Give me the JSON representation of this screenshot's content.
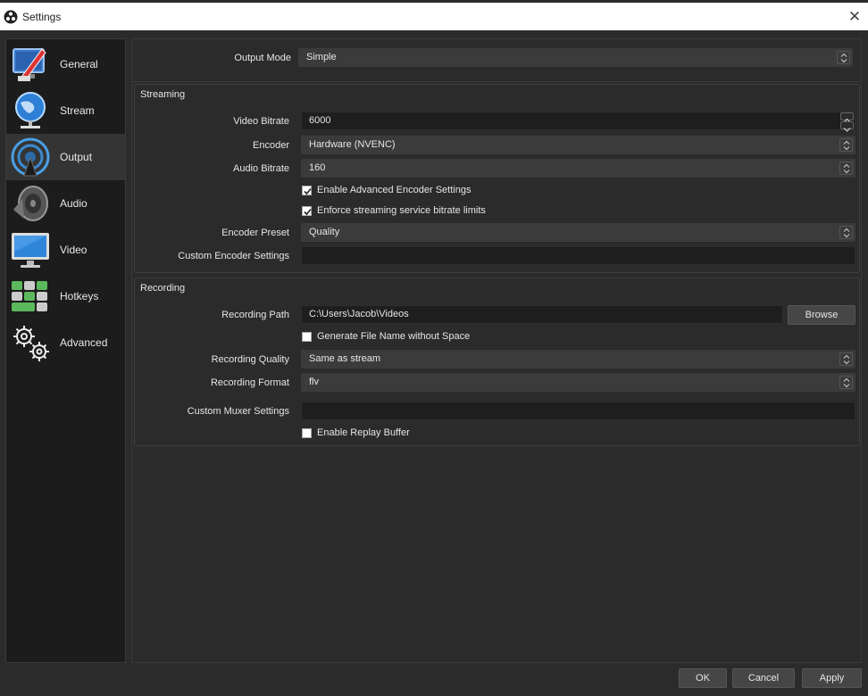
{
  "window": {
    "title": "Settings",
    "icon": "obs-logo-icon",
    "close_icon": "close-icon"
  },
  "sidebar": {
    "items": [
      {
        "label": "General",
        "icon": "general-settings-icon",
        "active": false
      },
      {
        "label": "Stream",
        "icon": "stream-globe-icon",
        "active": false
      },
      {
        "label": "Output",
        "icon": "output-broadcast-icon",
        "active": true
      },
      {
        "label": "Audio",
        "icon": "speaker-icon",
        "active": false
      },
      {
        "label": "Video",
        "icon": "monitor-icon",
        "active": false
      },
      {
        "label": "Hotkeys",
        "icon": "keyboard-icon",
        "active": false
      },
      {
        "label": "Advanced",
        "icon": "gears-icon",
        "active": false
      }
    ]
  },
  "output_mode": {
    "label": "Output Mode",
    "value": "Simple"
  },
  "streaming": {
    "title": "Streaming",
    "video_bitrate": {
      "label": "Video Bitrate",
      "value": "6000"
    },
    "encoder": {
      "label": "Encoder",
      "value": "Hardware (NVENC)"
    },
    "audio_bitrate": {
      "label": "Audio Bitrate",
      "value": "160"
    },
    "enable_advanced": {
      "label": "Enable Advanced Encoder Settings",
      "checked": true
    },
    "enforce_limits": {
      "label": "Enforce streaming service bitrate limits",
      "checked": true
    },
    "encoder_preset": {
      "label": "Encoder Preset",
      "value": "Quality"
    },
    "custom_encoder": {
      "label": "Custom Encoder Settings",
      "value": ""
    }
  },
  "recording": {
    "title": "Recording",
    "path": {
      "label": "Recording Path",
      "value": "C:\\Users\\Jacob\\Videos",
      "browse_label": "Browse"
    },
    "no_space": {
      "label": "Generate File Name without Space",
      "checked": false
    },
    "quality": {
      "label": "Recording Quality",
      "value": "Same as stream"
    },
    "format": {
      "label": "Recording Format",
      "value": "flv"
    },
    "custom_muxer": {
      "label": "Custom Muxer Settings",
      "value": ""
    },
    "replay_buffer": {
      "label": "Enable Replay Buffer",
      "checked": false
    }
  },
  "footer": {
    "ok_label": "OK",
    "cancel_label": "Cancel",
    "apply_label": "Apply"
  },
  "colors": {
    "background": "#2b2b2b",
    "sidebar": "#1c1c1c",
    "active_item": "#343434",
    "field": "#1e1e1e",
    "combo": "#3b3b3b"
  }
}
